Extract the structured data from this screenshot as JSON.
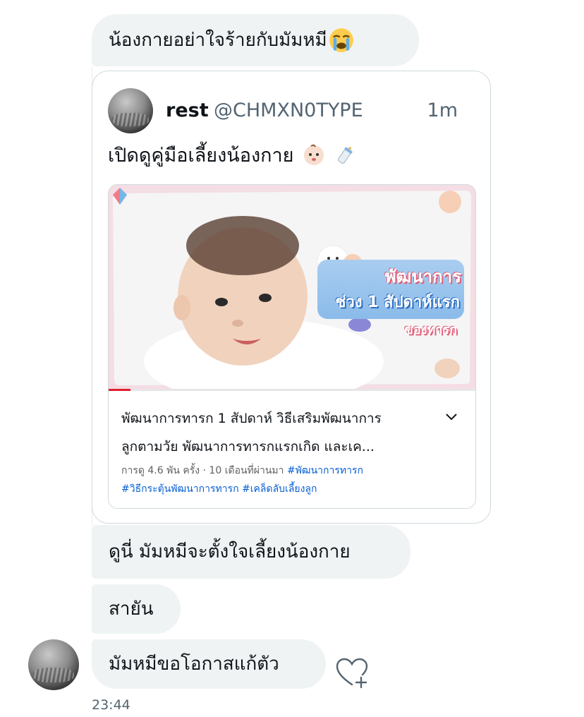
{
  "messages": {
    "m1": "น้องกายอย่าใจร้ายกับมัมหมี",
    "m2": "ดูนี่ มัมหมีจะตั้งใจเลี้ยงน้องกาย",
    "m3": "สายัน",
    "m4": "มัมหมีขอโอกาสแก้ตัว"
  },
  "quoted_tweet": {
    "name": "rest",
    "handle": "@CHMXN0TYPE",
    "time": "1m",
    "text": "เปิดดูคู่มือเลี้ยงน้องกาย"
  },
  "video_card": {
    "thumbnail_line1": "พัฒนาการ",
    "thumbnail_line2": "ช่วง 1 สัปดาห์แรก",
    "thumbnail_line3": "ของทารก",
    "progress": 0.06,
    "title_line1": "พัฒนาการทารก 1 สัปดาห์ วิธีเสริมพัฒนาการ",
    "title_line2": "ลูกตามวัย พัฒนาการทารกแรกเกิด และเค...",
    "meta": "การดู 4.6 พัน ครั้ง · 10 เดือนที่ผ่านมา",
    "hashtag1": "#พัฒนาการทารก",
    "hashtags2": "#วิธีกระตุ้นพัฒนาการทารก #เคล็ดลับเลี้ยงลูก"
  },
  "timestamp": "23:44",
  "icons": {
    "emoji1": "loudly-crying-face",
    "emoji2": "baby-face",
    "emoji3": "baby-bottle",
    "chevron": "chevron-down-icon",
    "react": "heart-plus-icon"
  },
  "colors": {
    "bubble": "#eff3f4",
    "link": "#065fd4",
    "muted": "#536471"
  }
}
